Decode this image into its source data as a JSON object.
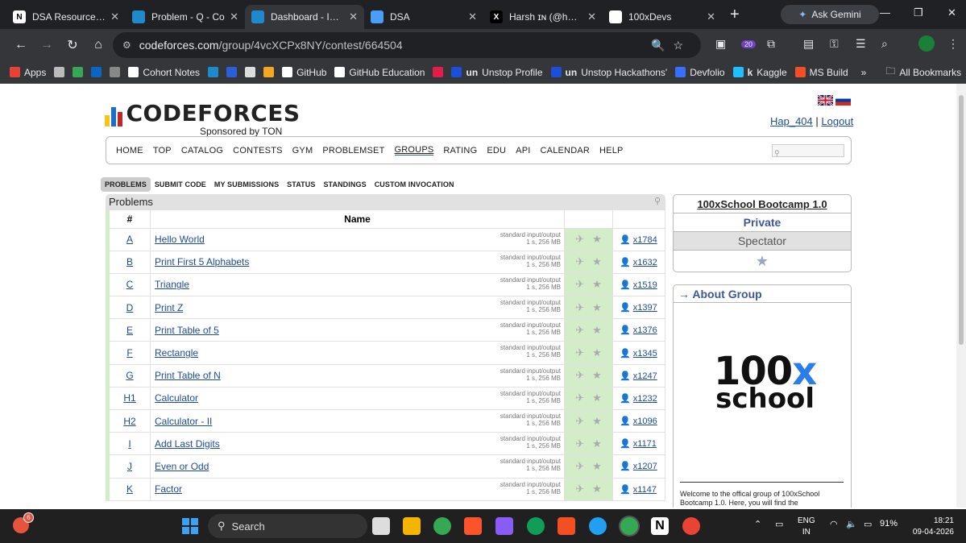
{
  "tabs": [
    {
      "title": "DSA Resources | N",
      "fav": "N",
      "color": "#ffffff",
      "active": false
    },
    {
      "title": "Problem - Q - Co",
      "fav": "",
      "color": "#1f8acb",
      "active": false
    },
    {
      "title": "Dashboard - Intro",
      "fav": "",
      "color": "#1f8acb",
      "active": true
    },
    {
      "title": "DSA",
      "fav": "",
      "color": "#4a9ff5",
      "active": false
    },
    {
      "title": "Harsh ɪɴ (@haptw",
      "fav": "X",
      "color": "#000000",
      "active": false
    },
    {
      "title": "100xDevs",
      "fav": "",
      "color": "#ffffff",
      "active": false
    }
  ],
  "ask_gemini": "Ask Gemini",
  "url": {
    "host": "codeforces.com",
    "path": "/group/4vcXCPx8NY/contest/664504"
  },
  "ext_badge": "20",
  "bookmarks": [
    {
      "label": "Apps",
      "color": "#e94235"
    },
    {
      "label": "",
      "color": "#bbbbbb"
    },
    {
      "label": "",
      "color": "#34a853"
    },
    {
      "label": "",
      "color": "#0a66c2"
    },
    {
      "label": "",
      "color": "#888888"
    },
    {
      "label": "Cohort Notes",
      "color": "#ffffff"
    },
    {
      "label": "",
      "color": "#1f8acb"
    },
    {
      "label": "",
      "color": "#2b5fd9"
    },
    {
      "label": "",
      "color": "#dddddd"
    },
    {
      "label": "",
      "color": "#f5a623"
    },
    {
      "label": "GitHub",
      "color": "#ffffff"
    },
    {
      "label": "GitHub Education",
      "color": "#ffffff"
    },
    {
      "label": "",
      "color": "#e11d48"
    },
    {
      "label": "Unstop Profile",
      "color": "#1c4fd8"
    },
    {
      "label": "Unstop Hackathons'",
      "color": "#1c4fd8"
    },
    {
      "label": "Devfolio",
      "color": "#3770ff"
    },
    {
      "label": "Kaggle",
      "color": "#20beff"
    },
    {
      "label": "MS Build",
      "color": "#f25022"
    }
  ],
  "bookmark_prefixes": {
    "unstop_profile": "un",
    "unstop_hackathons": "un",
    "kaggle": "k",
    "more": "»"
  },
  "all_bookmarks": "All Bookmarks",
  "logo": {
    "name": "CODEFORCES",
    "sponsor": "Sponsored by TON"
  },
  "user": {
    "handle": "Hap_404",
    "sep": "|",
    "logout": "Logout"
  },
  "menu": [
    "HOME",
    "TOP",
    "CATALOG",
    "CONTESTS",
    "GYM",
    "PROBLEMSET",
    "GROUPS",
    "RATING",
    "EDU",
    "API",
    "CALENDAR",
    "HELP"
  ],
  "menu_current": "GROUPS",
  "subnav": [
    "PROBLEMS",
    "SUBMIT CODE",
    "MY SUBMISSIONS",
    "STATUS",
    "STANDINGS",
    "CUSTOM INVOCATION"
  ],
  "problems_title": "Problems",
  "table_headers": {
    "idx": "#",
    "name": "Name"
  },
  "problems": [
    {
      "idx": "A",
      "name": "Hello World",
      "io": "standard input/output",
      "lim": "1 s, 256 MB",
      "solved": "x1784"
    },
    {
      "idx": "B",
      "name": "Print First 5 Alphabets",
      "io": "standard input/output",
      "lim": "1 s, 256 MB",
      "solved": "x1632"
    },
    {
      "idx": "C",
      "name": "Triangle",
      "io": "standard input/output",
      "lim": "1 s, 256 MB",
      "solved": "x1519"
    },
    {
      "idx": "D",
      "name": "Print Z",
      "io": "standard input/output",
      "lim": "1 s, 256 MB",
      "solved": "x1397"
    },
    {
      "idx": "E",
      "name": "Print Table of 5",
      "io": "standard input/output",
      "lim": "1 s, 256 MB",
      "solved": "x1376"
    },
    {
      "idx": "F",
      "name": "Rectangle",
      "io": "standard input/output",
      "lim": "1 s, 256 MB",
      "solved": "x1345"
    },
    {
      "idx": "G",
      "name": "Print Table of N",
      "io": "standard input/output",
      "lim": "1 s, 256 MB",
      "solved": "x1247"
    },
    {
      "idx": "H1",
      "name": "Calculator",
      "io": "standard input/output",
      "lim": "1 s, 256 MB",
      "solved": "x1232"
    },
    {
      "idx": "H2",
      "name": "Calculator - II",
      "io": "standard input/output",
      "lim": "1 s, 256 MB",
      "solved": "x1096"
    },
    {
      "idx": "I",
      "name": "Add Last Digits",
      "io": "standard input/output",
      "lim": "1 s, 256 MB",
      "solved": "x1171"
    },
    {
      "idx": "J",
      "name": "Even or Odd",
      "io": "standard input/output",
      "lim": "1 s, 256 MB",
      "solved": "x1207"
    },
    {
      "idx": "K",
      "name": "Factor",
      "io": "standard input/output",
      "lim": "1 s, 256 MB",
      "solved": "x1147"
    }
  ],
  "contest_box": {
    "title": "100xSchool Bootcamp 1.0",
    "type": "Private",
    "role": "Spectator"
  },
  "about": {
    "heading": "→ About Group",
    "logo_line1": "100",
    "logo_x": "x",
    "logo_line2": "school",
    "desc": "Welcome to the offical group of 100xSchool Bootcamp 1.0. Here, you will find the"
  },
  "taskbar": {
    "notif_count": "6",
    "search": "Search",
    "lang1": "ENG",
    "lang2": "IN",
    "battery": "91%",
    "time": "18:21",
    "date": "09-04-2026"
  }
}
